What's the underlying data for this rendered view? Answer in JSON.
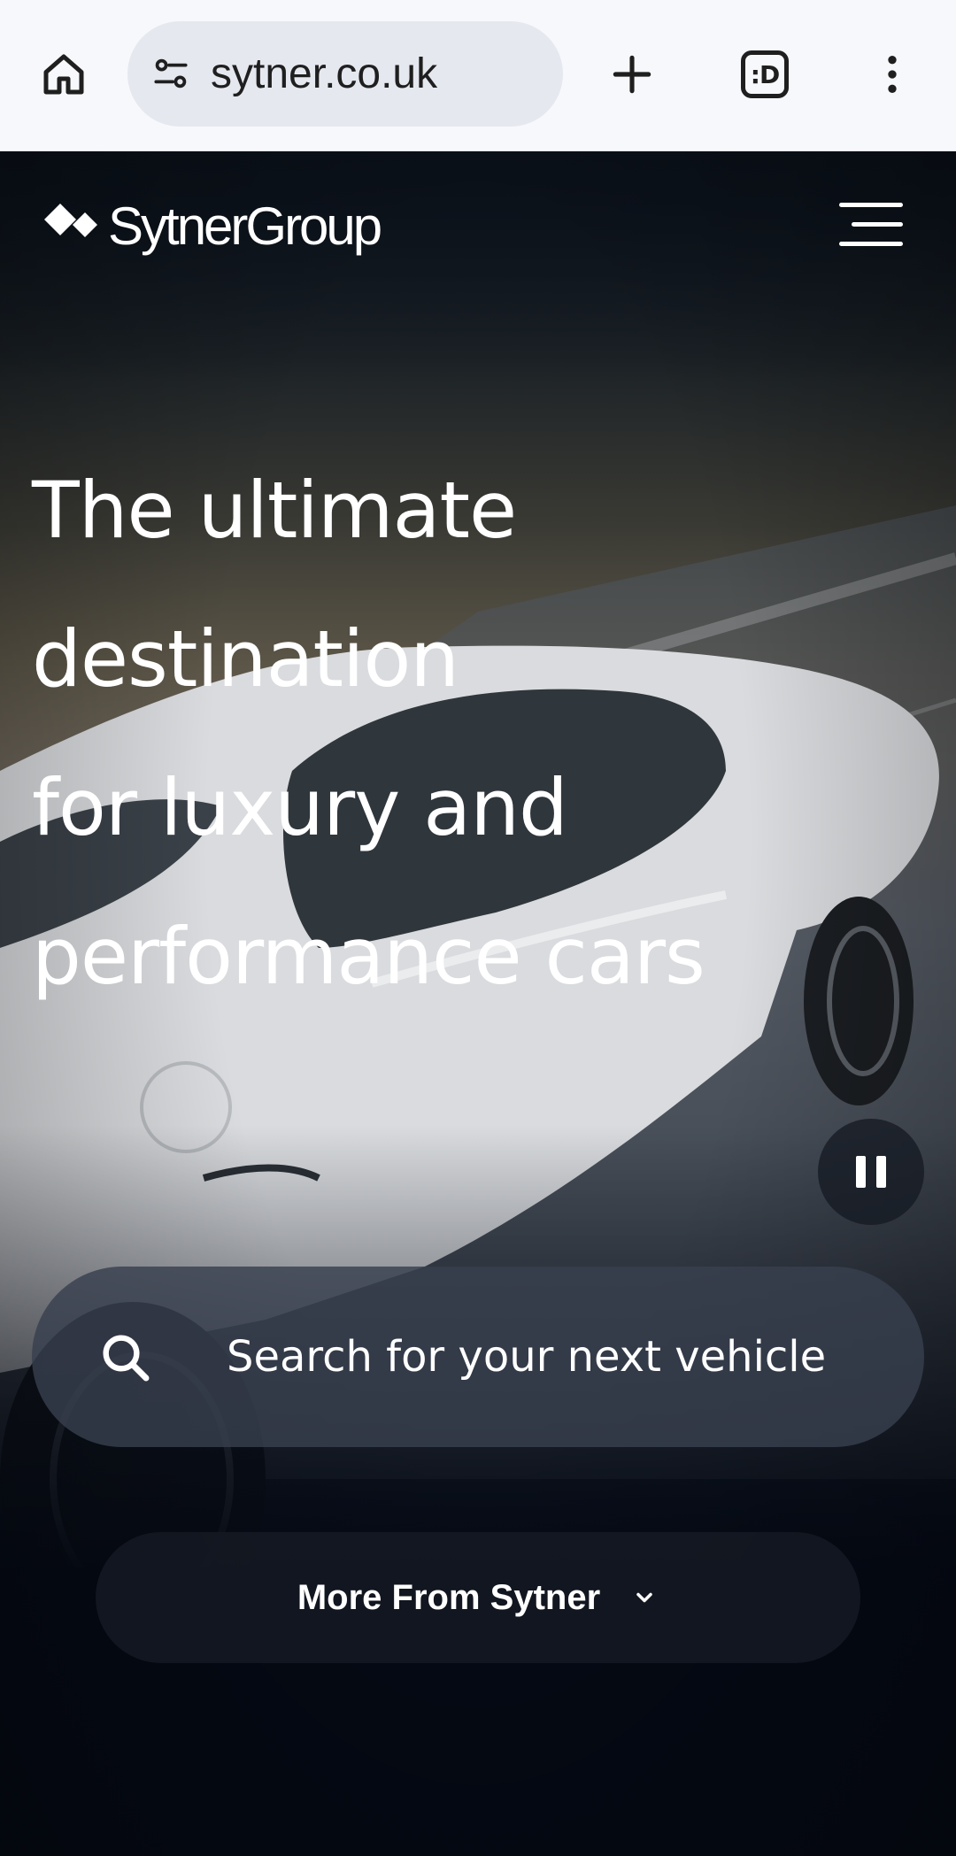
{
  "browser": {
    "url": "sytner.co.uk",
    "tabs_count_label": ":D",
    "icons": {
      "home": "home-icon",
      "site_settings": "site-settings-icon",
      "new_tab": "plus-icon",
      "menu": "more-vert-icon"
    }
  },
  "header": {
    "logo_text": "SytnerGroup",
    "menu_icon": "hamburger-menu-icon"
  },
  "hero": {
    "headline_line1": "The ultimate destination",
    "headline_line2": "for luxury and",
    "headline_line3": "performance cars",
    "pause_icon": "pause-icon"
  },
  "search": {
    "placeholder": "Search for your next vehicle",
    "icon": "search-icon"
  },
  "more": {
    "label": "More From Sytner",
    "icon": "chevron-down-icon"
  },
  "colors": {
    "chrome_bg": "#f7f8fb",
    "url_pill": "#e6e8f0",
    "page_dark": "#050a15",
    "text_light": "#ffffff"
  }
}
